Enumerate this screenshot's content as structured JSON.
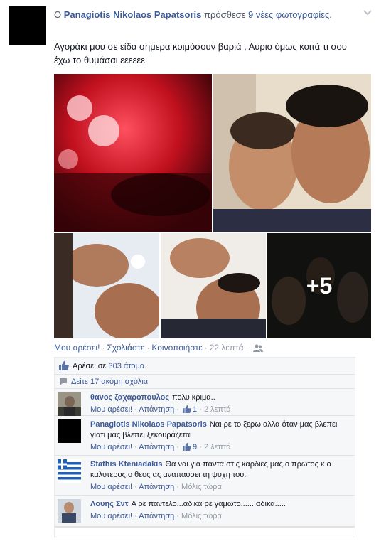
{
  "post": {
    "header_prefix": "Ο ",
    "author": "Panagiotis Nikolaos Papatsoris",
    "header_action": " πρόσθεσε ",
    "header_count": "9 νέες φωτογραφίες",
    "header_suffix": ".",
    "text": "Αγοράκι μου σε είδα σημερα κοιμόσουν βαριά , Αύριο όμως κοιτά τι σου έχω το θυμάσαι εεεεεε",
    "more_photos_label": "+5"
  },
  "actions": {
    "like": "Μου αρέσει!",
    "comment": "Σχολιάστε",
    "share": "Κοινοποιήστε",
    "time": "22 λεπτά",
    "separator": "·"
  },
  "ufi": {
    "likes_prefix": "Αρέσει σε ",
    "likes_count": "303 άτομα",
    "likes_suffix": ".",
    "view_more": "Δείτε 17 ακόμη σχόλια"
  },
  "comments": [
    {
      "name": "θανος ζαχαροπουλος",
      "text": "πολυ κριμα..",
      "like": "Μου αρέσει!",
      "reply": "Απάντηση",
      "likes": "1",
      "time": "2 λεπτά"
    },
    {
      "name": "Panagiotis Nikolaos Papatsoris",
      "text": "Ναι ρε το ξερω αλλα όταν μας βλεπει γιατι μας βλεπει ξεκουράζεται",
      "like": "Μου αρέσει!",
      "reply": "Απάντηση",
      "likes": "9",
      "time": "2 λεπτά"
    },
    {
      "name": "Stathis Kteniadakis",
      "text": "Θα ναι για παντα στις καρδιες μας.ο πρωτος κ ο καλυτερος.ο θεος ας αναπαυσει τη ψυχη του.",
      "like": "Μου αρέσει!",
      "reply": "Απάντηση",
      "time": "Μόλις τώρα"
    },
    {
      "name": "Λουης Σντ",
      "text": "Α ρε παντελο...αδικα ρε γαμωτο.......αδικα.....",
      "like": "Μου αρέσει!",
      "reply": "Απάντηση",
      "time": "Μόλις τώρα"
    }
  ],
  "colors": {
    "link": "#3b5998",
    "meta": "#9197a3",
    "ufi_background": "#f6f7f9"
  }
}
